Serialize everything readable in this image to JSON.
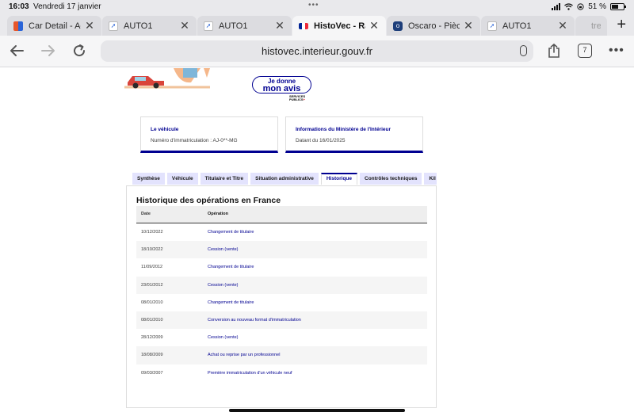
{
  "status": {
    "time": "16:03",
    "date": "Vendredi 17 janvier",
    "battery": "51 %"
  },
  "tabs": [
    {
      "title": "Car Detail - Ad",
      "favicon": "grid-icon",
      "active": false
    },
    {
      "title": "AUTO1",
      "favicon": "auto1-icon",
      "active": false
    },
    {
      "title": "AUTO1",
      "favicon": "auto1-icon",
      "active": false
    },
    {
      "title": "HistoVec - Rap",
      "favicon": "flag-fr-icon",
      "active": true
    },
    {
      "title": "Oscaro - Pièce",
      "favicon": "oscaro-icon",
      "active": false
    },
    {
      "title": "AUTO1",
      "favicon": "auto1-icon",
      "active": false
    },
    {
      "title": "tre a",
      "favicon": "",
      "active": false
    }
  ],
  "toolbar": {
    "url": "histovec.interieur.gouv.fr",
    "tab_count": "7"
  },
  "page": {
    "avis_line1": "Je donne",
    "avis_line2": "mon avis",
    "services_publics": "SERVICES PUBLICS+",
    "card_vehicle": {
      "title": "Le véhicule",
      "value": "Numéro d'immatriculation : AJ-0**-MG"
    },
    "card_ministry": {
      "title": "Informations du Ministère de l'Intérieur",
      "value": "Datant du 16/01/2025"
    },
    "report_tabs": [
      "Synthèse",
      "Véhicule",
      "Titulaire et Titre",
      "Situation administrative",
      "Historique",
      "Contrôles techniques",
      "Kil"
    ],
    "active_tab": "Historique",
    "history": {
      "title": "Historique des opérations en France",
      "col_date": "Date",
      "col_operation": "Opération",
      "rows": [
        {
          "date": "10/12/2022",
          "operation": "Changement de titulaire"
        },
        {
          "date": "18/10/2022",
          "operation": "Cession (vente)"
        },
        {
          "date": "11/09/2012",
          "operation": "Changement de titulaire"
        },
        {
          "date": "23/01/2012",
          "operation": "Cession (vente)"
        },
        {
          "date": "08/01/2010",
          "operation": "Changement de titulaire"
        },
        {
          "date": "08/01/2010",
          "operation": "Conversion au nouveau format d'immatriculation"
        },
        {
          "date": "28/12/2009",
          "operation": "Cession (vente)"
        },
        {
          "date": "18/08/2009",
          "operation": "Achat ou reprise par un professionnel"
        },
        {
          "date": "09/03/2007",
          "operation": "Première immatriculation d'un véhicule neuf"
        }
      ]
    }
  },
  "colors": {
    "primary_blue": "#000091",
    "tab_bg": "#e3e3fd",
    "chrome_bg": "#e9e9ec"
  }
}
